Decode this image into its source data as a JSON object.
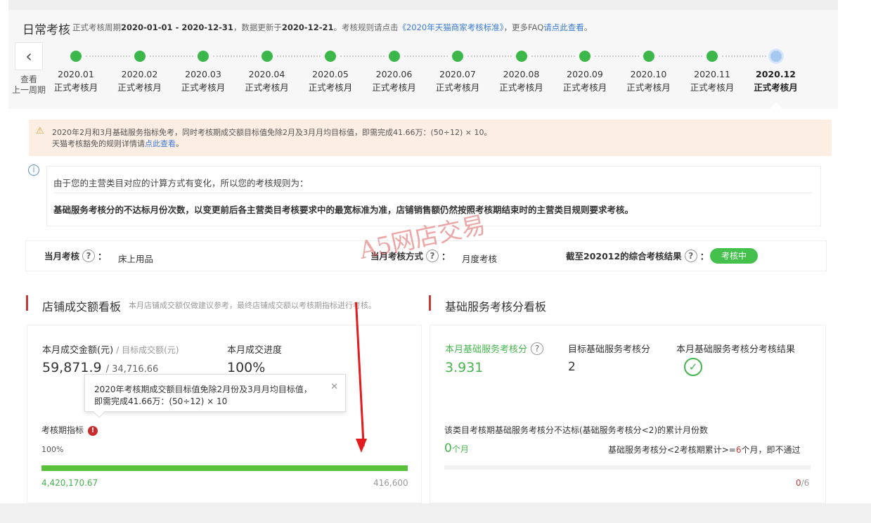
{
  "header": {
    "title": "日常考核",
    "subtitle_prefix": "正式考核周期",
    "period": "2020-01-01 - 2020-12-31",
    "update_prefix": "，数据更新于",
    "update_date": "2020-12-21",
    "rules_prefix": "。考核规则请点击",
    "rules_link": "《2020年天猫商家考核标准》",
    "faq_prefix": "，更多FAQ",
    "faq_link": "请点此查看",
    "faq_suffix": "。"
  },
  "timeline": {
    "back_label_1": "查看",
    "back_label_2": "上一周期",
    "months": [
      {
        "month": "2020.01",
        "status": "正式考核月"
      },
      {
        "month": "2020.02",
        "status": "正式考核月"
      },
      {
        "month": "2020.03",
        "status": "正式考核月"
      },
      {
        "month": "2020.04",
        "status": "正式考核月"
      },
      {
        "month": "2020.05",
        "status": "正式考核月"
      },
      {
        "month": "2020.06",
        "status": "正式考核月"
      },
      {
        "month": "2020.07",
        "status": "正式考核月"
      },
      {
        "month": "2020.08",
        "status": "正式考核月"
      },
      {
        "month": "2020.09",
        "status": "正式考核月"
      },
      {
        "month": "2020.10",
        "status": "正式考核月"
      },
      {
        "month": "2020.11",
        "status": "正式考核月"
      },
      {
        "month": "2020.12",
        "status": "正式考核月"
      }
    ]
  },
  "notice": {
    "line1": "2020年2月和3月基础服务指标免考，同时考核期成交额目标值免除2月及3月月均目标值，即需完成41.66万：(50÷12) × 10。",
    "line2_prefix": "天猫考核豁免的规则详情请",
    "line2_link": "点此查看",
    "line2_suffix": "。"
  },
  "rules": {
    "intro": "由于您的主营类目对应的计算方式有变化，所以您的考核规则为：",
    "detail": "基础服务考核分的不达标月份次数，以变更前后各主营类目考核要求中的最宽标准为准，店铺销售额仍然按照考核期结束时的主营类目规则要求考核。"
  },
  "current": {
    "month_label": "当月考核",
    "category": "床上用品",
    "method_label": "当月考核方式",
    "method": "月度考核",
    "result_label": "截至202012的综合考核结果",
    "result": "考核中",
    "colon": "："
  },
  "sales_board": {
    "title": "店铺成交额看板",
    "note": "本月店铺成交额仅做建议参考，最终店铺成交额以考核期指标进行考核。",
    "amount_label": "本月成交金额(元)",
    "target_label": "/ 目标成交额(元)",
    "amount": "59,871.9",
    "target": "/ 34,716.66",
    "progress_label": "本月成交进度",
    "progress": "100%",
    "tooltip_line1": "2020年考核期成交额目标值免除2月份及3月月均目标值，",
    "tooltip_line2": "即需完成41.66万：(50÷12) × 10",
    "period_label": "考核期指标",
    "period_percent": "100%",
    "period_progress": 1.0,
    "period_actual": "4,420,170.67",
    "period_target": "416,600"
  },
  "service_board": {
    "title": "基础服务考核分看板",
    "score_label": "本月基础服务考核分",
    "score": "3.931",
    "target_label": "目标基础服务考核分",
    "target": "2",
    "result_label": "本月基础服务考核分考核结果",
    "fail_desc": "该类目考核期基础服务考核分不达标(基础服务考核分<2)的累计月份数",
    "fail_count": "0",
    "fail_unit": "个月",
    "rule_prefix": "基础服务考核分<2考核期累计>=",
    "rule_limit": "6",
    "rule_suffix": "个月，即不通过",
    "ratio_num": "0",
    "ratio_den": "/6"
  },
  "watermark": "A5网店交易",
  "colors": {
    "green": "#44b54c",
    "red_accent": "#c23a3a",
    "link_blue": "#3a7bd5",
    "notice_bg": "#fdeee4"
  }
}
